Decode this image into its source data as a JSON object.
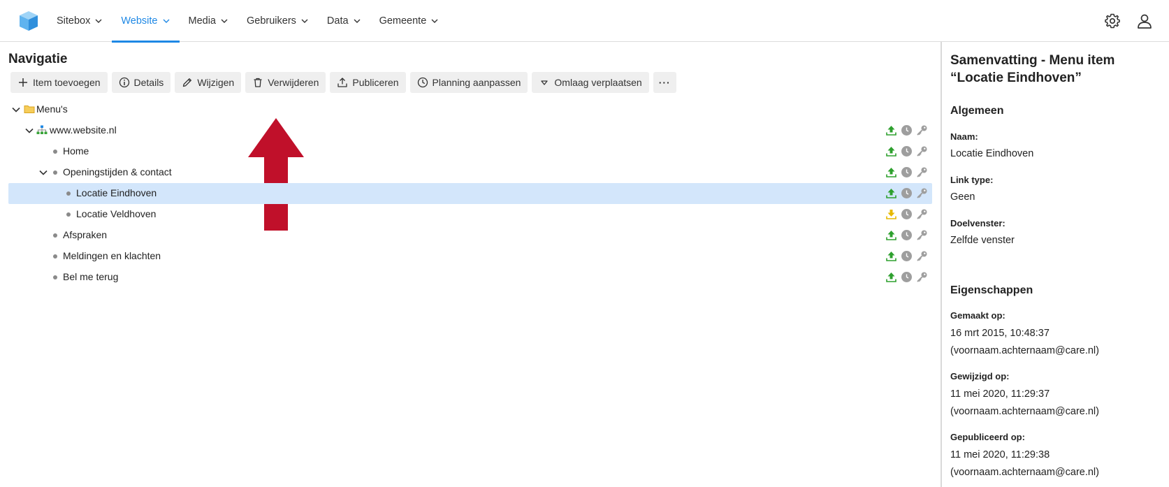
{
  "nav": {
    "items": [
      {
        "label": "Sitebox"
      },
      {
        "label": "Website"
      },
      {
        "label": "Media"
      },
      {
        "label": "Gebruikers"
      },
      {
        "label": "Data"
      },
      {
        "label": "Gemeente"
      }
    ],
    "active_index": 1,
    "accent_color": "#1e88e5"
  },
  "page": {
    "title": "Navigatie"
  },
  "toolbar": {
    "add": "Item toevoegen",
    "details": "Details",
    "edit": "Wijzigen",
    "delete": "Verwijderen",
    "publish": "Publiceren",
    "schedule": "Planning aanpassen",
    "move_down": "Omlaag verplaatsen",
    "more": "···"
  },
  "tree": {
    "root": "Menu's",
    "site": "www.website.nl",
    "items": [
      {
        "label": "Home",
        "status": "published"
      },
      {
        "label": "Openingstijden & contact",
        "status": "published"
      },
      {
        "label": "Locatie Eindhoven",
        "status": "published",
        "selected": true
      },
      {
        "label": "Locatie Veldhoven",
        "status": "pending"
      },
      {
        "label": "Afspraken",
        "status": "published"
      },
      {
        "label": "Meldingen en klachten",
        "status": "published"
      },
      {
        "label": "Bel me terug",
        "status": "published"
      }
    ],
    "colors": {
      "published": "#2ea02e",
      "pending": "#e6b800",
      "muted": "#9e9e9e",
      "selected_bg": "#d3e6fb"
    }
  },
  "summary": {
    "title": "Samenvatting - Menu item “Locatie Eindhoven”",
    "general_heading": "Algemeen",
    "name_label": "Naam:",
    "name_value": "Locatie Eindhoven",
    "link_type_label": "Link type:",
    "link_type_value": "Geen",
    "target_label": "Doelvenster:",
    "target_value": "Zelfde venster",
    "props_heading": "Eigenschappen",
    "created_label": "Gemaakt op:",
    "created_date": "16 mrt 2015, 10:48:37",
    "created_by": "(voornaam.achternaam@care.nl)",
    "modified_label": "Gewijzigd op:",
    "modified_date": "11 mei 2020, 11:29:37",
    "modified_by": "(voornaam.achternaam@care.nl)",
    "published_label": "Gepubliceerd op:",
    "published_date": "11 mei 2020, 11:29:38",
    "published_by": "(voornaam.achternaam@care.nl)"
  }
}
